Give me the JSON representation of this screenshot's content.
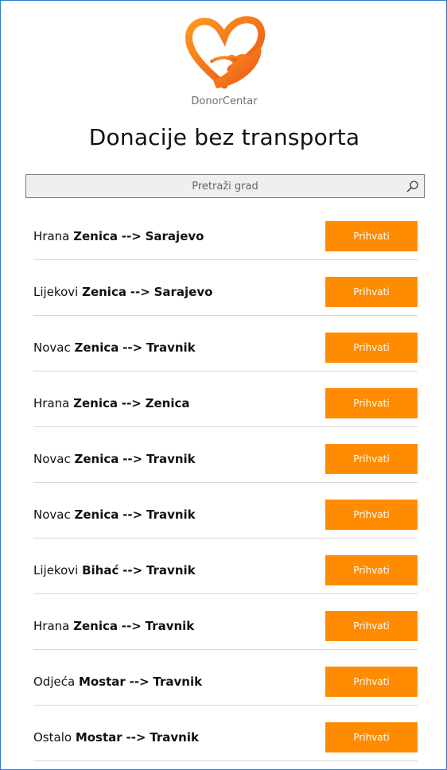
{
  "app": {
    "brand": "DonorCentar",
    "logo_icon": "heart-hand-icon",
    "title": "Donacije bez transporta"
  },
  "search": {
    "placeholder": "Pretraži grad",
    "icon": "search-icon"
  },
  "donations": [
    {
      "type": "Hrana",
      "from": "Zenica",
      "arrow": "-->",
      "to": "Sarajevo",
      "button": "Prihvati"
    },
    {
      "type": "Lijekovi",
      "from": "Zenica",
      "arrow": "-->",
      "to": "Sarajevo",
      "button": "Prihvati"
    },
    {
      "type": "Novac",
      "from": "Zenica",
      "arrow": "-->",
      "to": "Travnik",
      "button": "Prihvati"
    },
    {
      "type": "Hrana",
      "from": "Zenica",
      "arrow": "-->",
      "to": "Zenica",
      "button": "Prihvati"
    },
    {
      "type": "Novac",
      "from": "Zenica",
      "arrow": "-->",
      "to": "Travnik",
      "button": "Prihvati"
    },
    {
      "type": "Novac",
      "from": "Zenica",
      "arrow": "-->",
      "to": "Travnik",
      "button": "Prihvati"
    },
    {
      "type": "Lijekovi",
      "from": "Bihać",
      "arrow": "-->",
      "to": "Travnik",
      "button": "Prihvati"
    },
    {
      "type": "Hrana",
      "from": "Zenica",
      "arrow": "-->",
      "to": "Travnik",
      "button": "Prihvati"
    },
    {
      "type": "Odjeća",
      "from": "Mostar",
      "arrow": "-->",
      "to": "Travnik",
      "button": "Prihvati"
    },
    {
      "type": "Ostalo",
      "from": "Mostar",
      "arrow": "-->",
      "to": "Travnik",
      "button": "Prihvati"
    }
  ],
  "colors": {
    "accent": "#ff8c00",
    "logo_gradient_start": "#ffb347",
    "logo_gradient_end": "#e8501a"
  }
}
